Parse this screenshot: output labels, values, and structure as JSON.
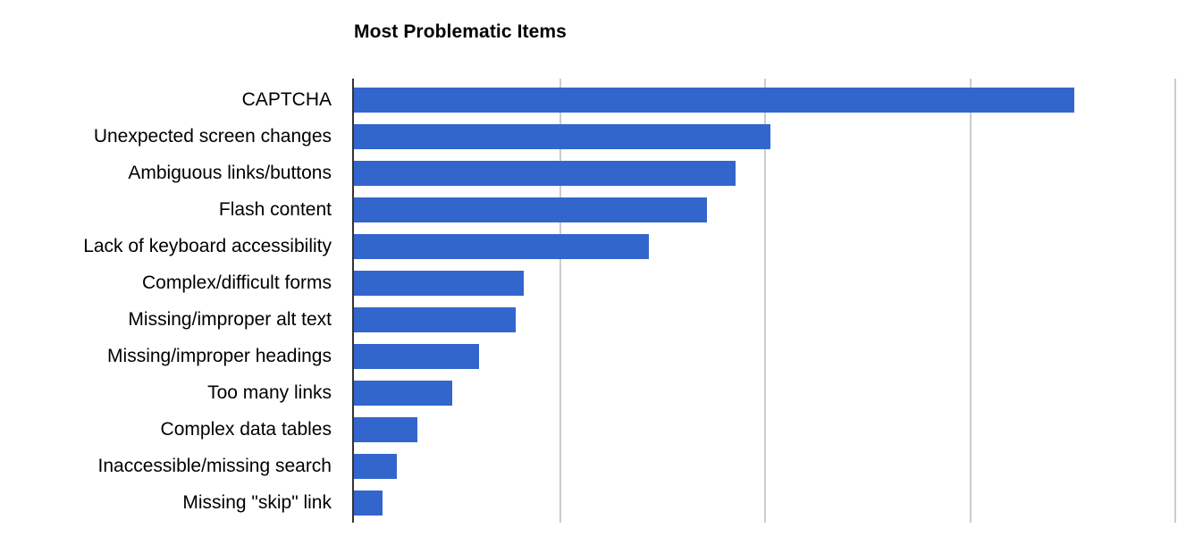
{
  "chart_data": {
    "type": "bar",
    "orientation": "horizontal",
    "title": "Most Problematic Items",
    "xlabel": "",
    "ylabel": "",
    "xlim": [
      0,
      4
    ],
    "gridlines": [
      0,
      1,
      2,
      3,
      4
    ],
    "grid": true,
    "legend": false,
    "bar_color": "#3366cc",
    "gridline_color": "#cccccc",
    "axis_color": "#333333",
    "categories": [
      "CAPTCHA",
      "Unexpected screen changes",
      "Ambiguous links/buttons",
      "Flash content",
      "Lack of keyboard accessibility",
      "Complex/difficult forms",
      "Missing/improper alt text",
      "Missing/improper headings",
      "Too many links",
      "Complex data tables",
      "Inaccessible/missing search",
      "Missing \"skip\" link"
    ],
    "values": [
      3.51,
      2.03,
      1.86,
      1.72,
      1.44,
      0.83,
      0.79,
      0.61,
      0.48,
      0.31,
      0.21,
      0.14
    ]
  }
}
